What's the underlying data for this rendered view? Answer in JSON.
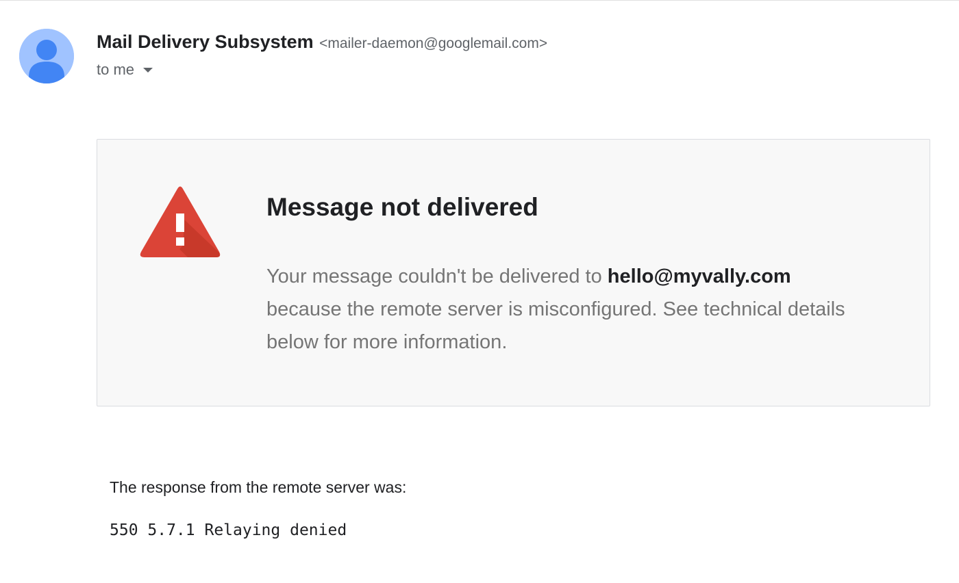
{
  "header": {
    "sender_name": "Mail Delivery Subsystem",
    "sender_email": "<mailer-daemon@googlemail.com>",
    "recipient_label": "to me",
    "avatar_icon": "person-avatar-icon",
    "dropdown_icon": "caret-down-icon"
  },
  "card": {
    "icon": "warning-triangle-icon",
    "title": "Message not delivered",
    "body_prefix": "Your message couldn't be delivered to ",
    "address": "hello@myvally.com",
    "body_suffix": " because the remote server is misconfigured. See technical details below for more information."
  },
  "response": {
    "label": "The response from the remote server was:",
    "code": "550 5.7.1 Relaying denied"
  },
  "colors": {
    "avatar_bg": "#a0c3ff",
    "avatar_fg": "#4285f4",
    "warning_red": "#db4437",
    "card_bg": "#f8f8f8",
    "muted_text": "#757575"
  }
}
